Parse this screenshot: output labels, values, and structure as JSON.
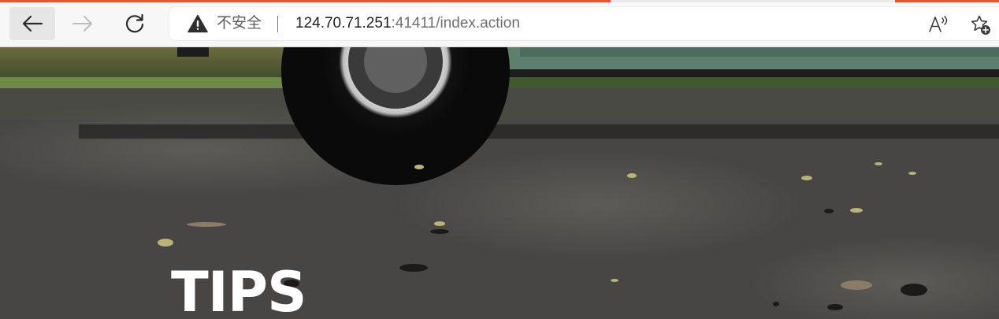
{
  "browser": {
    "security_label": "不安全",
    "url_host": "124.70.71.251",
    "url_rest": ":41411/index.action",
    "icons": {
      "back": "back-arrow-icon",
      "forward": "forward-arrow-icon",
      "reload": "reload-icon",
      "warning": "warning-triangle-icon",
      "read_aloud": "read-aloud-icon",
      "favorites": "add-favorite-icon"
    },
    "accent_color": "#e2553b"
  },
  "hero": {
    "heading": "TIPS"
  }
}
